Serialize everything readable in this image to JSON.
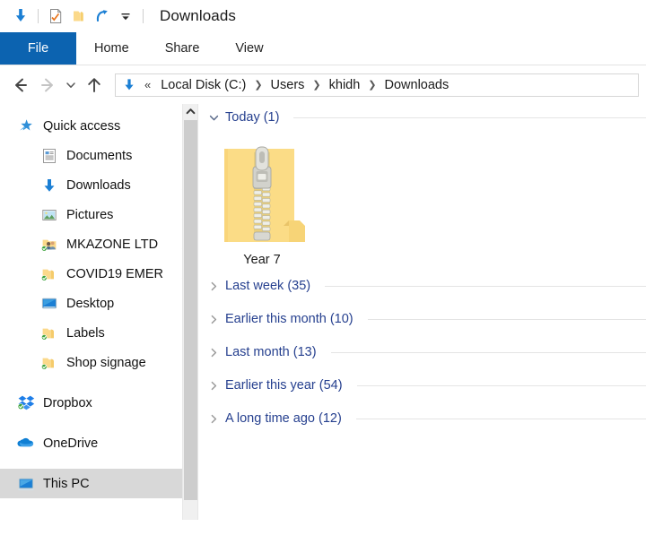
{
  "window": {
    "title": "Downloads",
    "quick_access_toolbar": [
      {
        "name": "downloads-arrow-icon",
        "label": "Downloads"
      },
      {
        "name": "properties-icon",
        "label": "Properties"
      },
      {
        "name": "new-folder-icon",
        "label": "New folder"
      },
      {
        "name": "redo-icon",
        "label": "Redo"
      },
      {
        "name": "customize-toolbar-chevron-icon",
        "label": "Customize Quick Access Toolbar"
      }
    ]
  },
  "ribbon": {
    "tabs": [
      {
        "label": "File",
        "active": true
      },
      {
        "label": "Home",
        "active": false
      },
      {
        "label": "Share",
        "active": false
      },
      {
        "label": "View",
        "active": false
      }
    ]
  },
  "address_bar": {
    "back_label": "Back",
    "forward_label": "Forward",
    "recent_label": "Recent locations",
    "up_label": "Up",
    "overflow": "«",
    "crumbs": [
      "Local Disk (C:)",
      "Users",
      "khidh",
      "Downloads"
    ],
    "separator": "❯"
  },
  "sidebar": {
    "items": [
      {
        "label": "Quick access",
        "icon": "quick-access-star-icon",
        "level": 0,
        "pinned": false,
        "synced": false,
        "selected": false
      },
      {
        "label": "Documents",
        "icon": "documents-icon",
        "level": 1,
        "pinned": true,
        "synced": false,
        "selected": false
      },
      {
        "label": "Downloads",
        "icon": "downloads-arrow-icon",
        "level": 1,
        "pinned": true,
        "synced": false,
        "selected": false
      },
      {
        "label": "Pictures",
        "icon": "pictures-icon",
        "level": 1,
        "pinned": true,
        "synced": false,
        "selected": false
      },
      {
        "label": "MKAZONE LTD",
        "icon": "shared-folder-icon",
        "level": 1,
        "pinned": true,
        "synced": true,
        "selected": false
      },
      {
        "label": "COVID19 EMER",
        "icon": "folder-icon",
        "level": 1,
        "pinned": true,
        "synced": true,
        "selected": false
      },
      {
        "label": "Desktop",
        "icon": "desktop-icon",
        "level": 1,
        "pinned": false,
        "synced": false,
        "selected": false
      },
      {
        "label": "Labels",
        "icon": "folder-icon",
        "level": 1,
        "pinned": false,
        "synced": true,
        "selected": false
      },
      {
        "label": "Shop signage",
        "icon": "folder-icon",
        "level": 1,
        "pinned": false,
        "synced": true,
        "selected": false
      },
      {
        "label": "Dropbox",
        "icon": "dropbox-icon",
        "level": 0,
        "pinned": false,
        "synced": true,
        "selected": false
      },
      {
        "label": "OneDrive",
        "icon": "onedrive-cloud-icon",
        "level": 0,
        "pinned": false,
        "synced": false,
        "selected": false
      },
      {
        "label": "This PC",
        "icon": "this-pc-icon",
        "level": 0,
        "pinned": false,
        "synced": false,
        "selected": true
      }
    ]
  },
  "content": {
    "groups": [
      {
        "label": "Today (1)",
        "expanded": true,
        "items": [
          {
            "label": "Year 7",
            "icon": "zipped-folder-icon"
          }
        ]
      },
      {
        "label": "Last week (35)",
        "expanded": false,
        "items": []
      },
      {
        "label": "Earlier this month (10)",
        "expanded": false,
        "items": []
      },
      {
        "label": "Last month (13)",
        "expanded": false,
        "items": []
      },
      {
        "label": "Earlier this year (54)",
        "expanded": false,
        "items": []
      },
      {
        "label": "A long time ago (12)",
        "expanded": false,
        "items": []
      }
    ]
  },
  "colors": {
    "file_tab_blue": "#0c63b0",
    "group_header_blue": "#26408f",
    "accent_arrow_blue": "#1b7fd4",
    "folder_yellow": "#fbdc86",
    "selection_grey": "#d8d8d8"
  }
}
